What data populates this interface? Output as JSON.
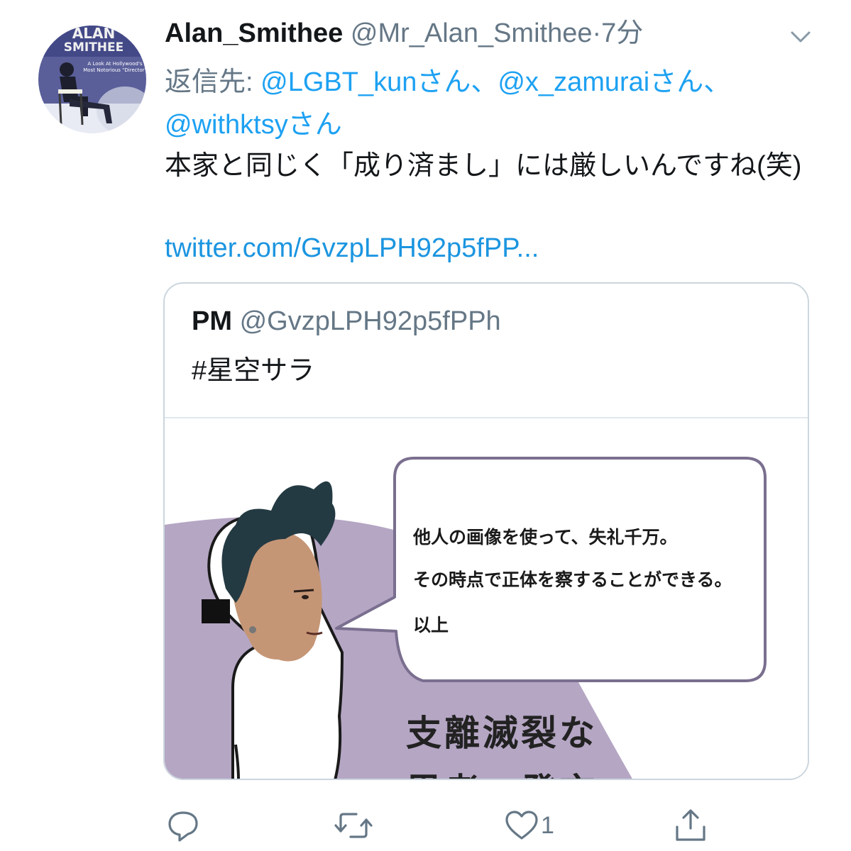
{
  "tweet": {
    "display_name": "Alan_Smithee",
    "handle": "@Mr_Alan_Smithee",
    "separator": "·",
    "time": "7分",
    "reply_prefix": "返信先: ",
    "reply_mentions": [
      "@LGBT_kunさん、",
      "@x_zamuraiさん、",
      "@withktsyさん"
    ],
    "text": "本家と同じく「成り済まし」には厳しいんですね(笑)",
    "link": "twitter.com/GvzpLPH92p5fPP..."
  },
  "avatar": {
    "title_line1": "ALAN",
    "title_line2": "SMITHEE",
    "tagline_line1": "A Look At Hollywood's",
    "tagline_line2": "Most Notorious \"Director\""
  },
  "quote": {
    "display_name": "PM",
    "handle": "@GvzpLPH92p5fPPh",
    "text": "#星空サラ",
    "image": {
      "bubble_lines": [
        "他人の画像を使って、失礼千万。",
        "その時点で正体を察することができる。",
        "以上"
      ],
      "big_lines": [
        "支離滅裂な",
        "思考・発言"
      ]
    }
  },
  "actions": {
    "reply_icon": "reply-icon",
    "retweet_icon": "retweet-icon",
    "like_icon": "heart-icon",
    "like_count": "1",
    "share_icon": "share-icon"
  },
  "colors": {
    "link": "#1da1f2",
    "secondary_text": "#657786",
    "card_border": "#ccd6dd",
    "image_purple": "#b5a6c4"
  }
}
